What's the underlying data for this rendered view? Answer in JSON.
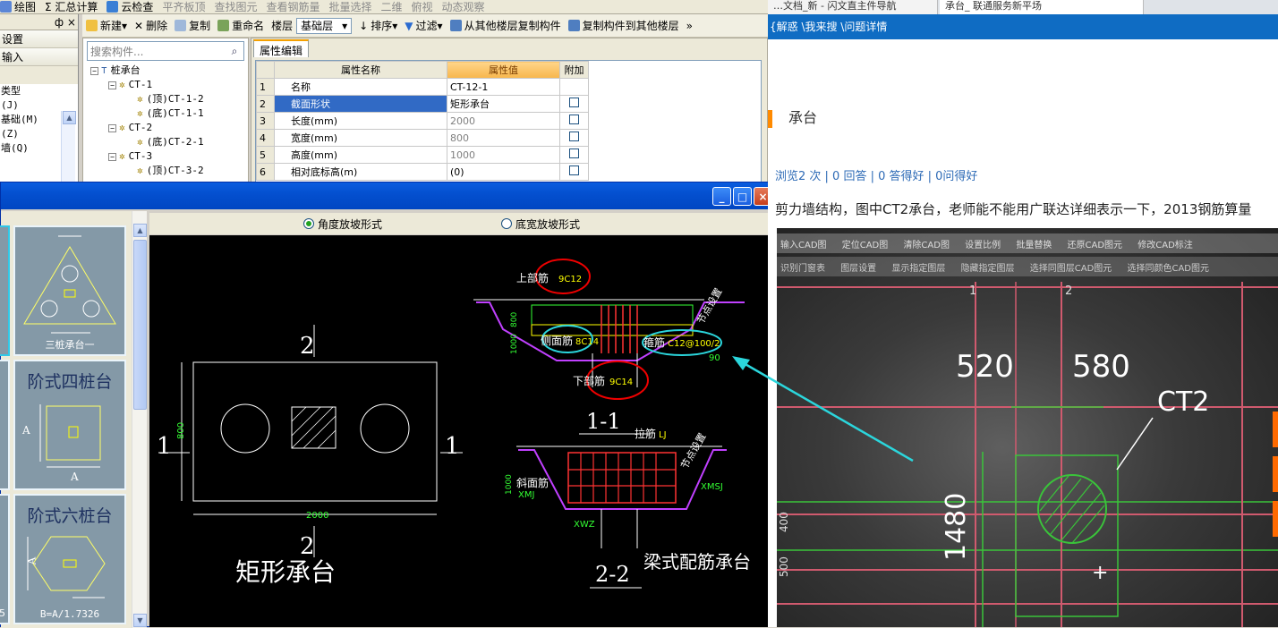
{
  "topbar": {
    "items": [
      "绘图",
      "Σ 汇总计算",
      "云检查",
      "平齐板顶",
      "查找图元",
      "查看钢筋量",
      "批量选择",
      "二维",
      "俯视",
      "动态观察"
    ]
  },
  "leftnav": {
    "header_pin": "ф ×",
    "row1": "设置",
    "row2": "输入",
    "list": [
      "类型",
      "(J)",
      "基础(M)",
      "(Z)",
      "墙(Q)"
    ]
  },
  "toolbar2": {
    "new": "新建",
    "delete": "删除",
    "copy": "复制",
    "rename": "重命名",
    "floor_label": "楼层",
    "floor_value": "基础层",
    "sort": "排序",
    "filter": "过滤",
    "copy_from": "从其他楼层复制构件",
    "copy_to": "复制构件到其他楼层",
    "more": "»"
  },
  "tree": {
    "search_placeholder": "搜索构件...",
    "nodes": [
      {
        "label": "桩承台",
        "level": 0,
        "exp": "−"
      },
      {
        "label": "CT-1",
        "level": 1,
        "exp": "−"
      },
      {
        "label": "(顶)CT-1-2",
        "level": 2
      },
      {
        "label": "(底)CT-1-1",
        "level": 2
      },
      {
        "label": "CT-2",
        "level": 1,
        "exp": "−"
      },
      {
        "label": "(底)CT-2-1",
        "level": 2
      },
      {
        "label": "CT-3",
        "level": 1,
        "exp": "−"
      },
      {
        "label": "(顶)CT-3-2",
        "level": 2
      }
    ]
  },
  "props": {
    "tab": "属性编辑",
    "col_name": "属性名称",
    "col_value": "属性值",
    "col_extra": "附加",
    "rows": [
      {
        "n": "1",
        "name": "名称",
        "value": "CT-12-1",
        "chk": false,
        "gray": false
      },
      {
        "n": "2",
        "name": "截面形状",
        "value": "矩形承台",
        "chk": true,
        "gray": false
      },
      {
        "n": "3",
        "name": "长度(mm)",
        "value": "2000",
        "chk": true,
        "gray": true
      },
      {
        "n": "4",
        "name": "宽度(mm)",
        "value": "800",
        "chk": true,
        "gray": true
      },
      {
        "n": "5",
        "name": "高度(mm)",
        "value": "1000",
        "chk": true,
        "gray": true
      },
      {
        "n": "6",
        "name": "相对底标高(m)",
        "value": "(0)",
        "chk": true,
        "gray": false
      }
    ]
  },
  "dialog": {
    "min": "_",
    "max": "□",
    "close": "×",
    "radio1": "角度放坡形式",
    "radio2": "底宽放坡形式",
    "thumbs": {
      "t1_caption": "三桩承台一",
      "t2_title": "阶式四桩台",
      "t2_a": "A",
      "t3_title": "阶式六桩台",
      "t3_a": "A",
      "t3_caption": "B=A/1.7326",
      "edge_num": "5"
    },
    "drawing": {
      "sec2_top": "2",
      "sec2_bot": "2",
      "sec1_left": "1",
      "sec1_right": "1",
      "dim_800": "800",
      "dim_2000": "2000",
      "shape_name": "矩形承台",
      "top_bar": "上部筋",
      "top_bar_val": "9C12",
      "side_bar": "侧面筋",
      "side_bar_val": "8C14",
      "stirrup": "箍筋",
      "stirrup_val": "C12@100/2",
      "bottom_bar": "下部筋",
      "bottom_bar_val": "9C14",
      "node_setting": "节点设置",
      "h800": "800",
      "h1000": "1000",
      "angle": "90",
      "sec11": "1-1",
      "tie_bar": "拉筋",
      "tie_val": "LJ",
      "slope_bar": "斜面筋",
      "xmj": "XMJ",
      "xmsj": "XMSJ",
      "xwz": "XWZ",
      "h1000b": "1000",
      "sec22": "2-2",
      "beam_type": "梁式配筋承台"
    }
  },
  "browser": {
    "tab1": "…文档_新 - 闪文直主件导航",
    "tab2": "承台_ 联通服务新平场",
    "crumb": "{解惑 \\我来搜 \\问题详情",
    "title": "承台",
    "stats": "浏览2 次 | 0 回答 | 0 答得好 | 0问得好",
    "question": "剪力墙结构，图中CT2承台，老师能不能用广联达详细表示一下，2013钢筋算量",
    "photo": {
      "dim1": "520",
      "dim2": "580",
      "label": "CT2",
      "dim3": "1480",
      "dim4": "400",
      "dim5": "500",
      "grid1": "1",
      "grid2": "2",
      "toolbar1": [
        "输入CAD图",
        "定位CAD图",
        "清除CAD图",
        "设置比例",
        "批量替换",
        "还原CAD图元",
        "修改CAD标注"
      ],
      "toolbar2": [
        "识别门窗表",
        "图层设置",
        "显示指定图层",
        "隐藏指定图层",
        "选择同图层CAD图元",
        "选择同颜色CAD图元"
      ]
    }
  }
}
